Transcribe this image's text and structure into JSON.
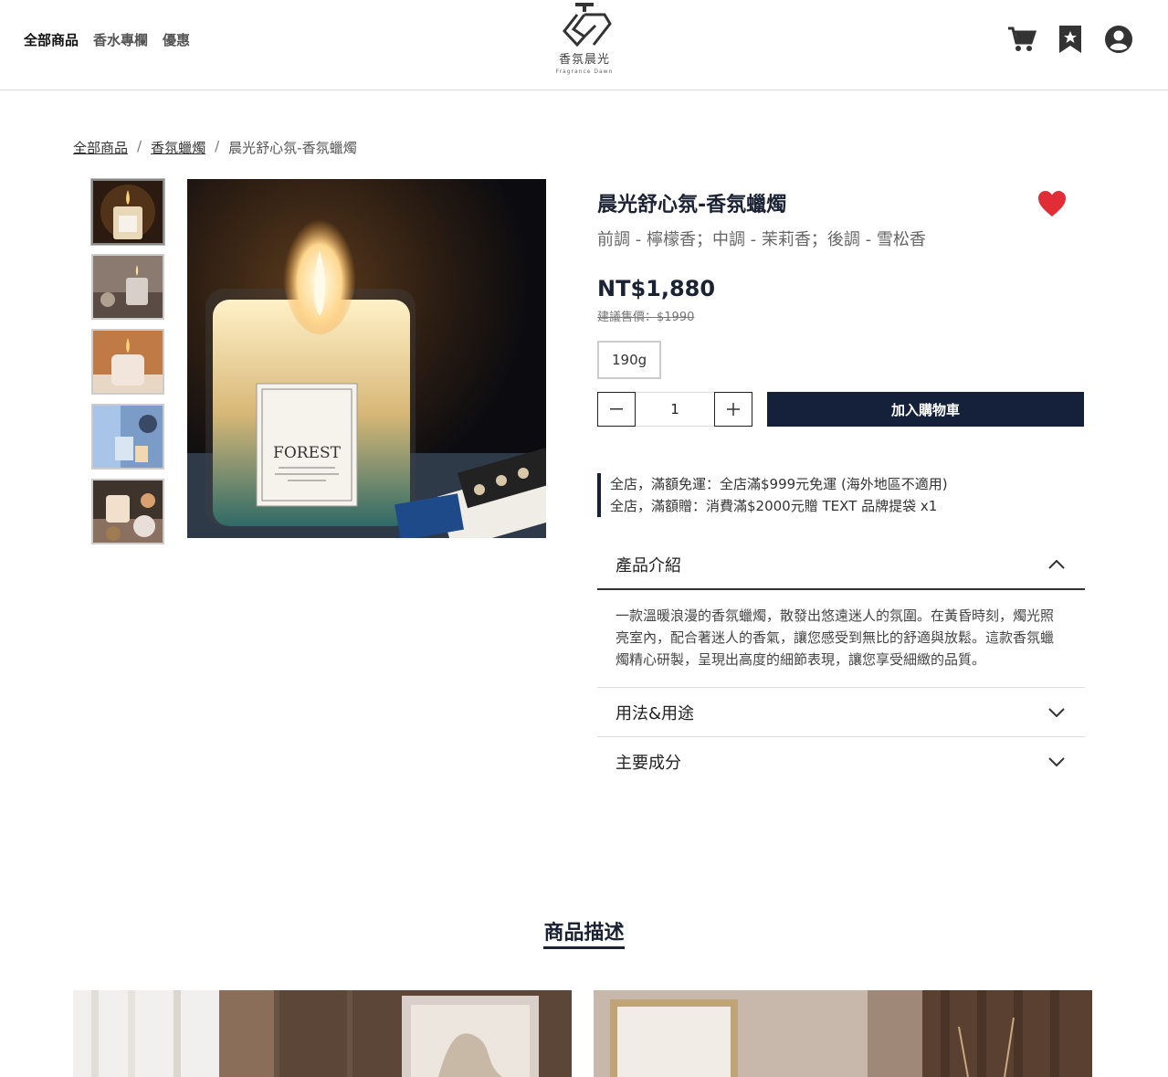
{
  "header": {
    "nav": [
      "全部商品",
      "香水專欄",
      "優惠"
    ],
    "brand_name": "香氛晨光",
    "brand_sub": "Fragrance Dawn"
  },
  "breadcrumb": {
    "items": [
      "全部商品",
      "香氛蠟燭"
    ],
    "current": "晨光舒心氛-香氛蠟燭"
  },
  "product": {
    "title": "晨光舒心氛-香氛蠟燭",
    "notes": "前調 - 檸檬香；中調 - 茉莉香；後調 - 雪松香",
    "price": "NT$1,880",
    "original_price": "建議售價：$1990",
    "variant": "190g",
    "quantity": "1",
    "add_to_cart": "加入購物車",
    "label_text": "FOREST"
  },
  "promos": [
    "全店，滿額免運：全店滿$999元免運 (海外地區不適用)",
    "全店，滿額贈：消費滿$2000元贈 TEXT 品牌提袋 x1"
  ],
  "accordion": [
    {
      "label": "產品介紹",
      "open": true,
      "body": "一款溫暖浪漫的香氛蠟燭，散發出悠遠迷人的氛圍。在黃昏時刻，燭光照亮室內，配合著迷人的香氣，讓您感受到無比的舒適與放鬆。這款香氛蠟燭精心研製，呈現出高度的細節表現，讓您享受細緻的品質。"
    },
    {
      "label": "用法&用途",
      "open": false
    },
    {
      "label": "主要成分",
      "open": false
    }
  ],
  "description": {
    "title": "商品描述"
  },
  "colors": {
    "primary": "#15213a",
    "heart": "#e02d36"
  }
}
